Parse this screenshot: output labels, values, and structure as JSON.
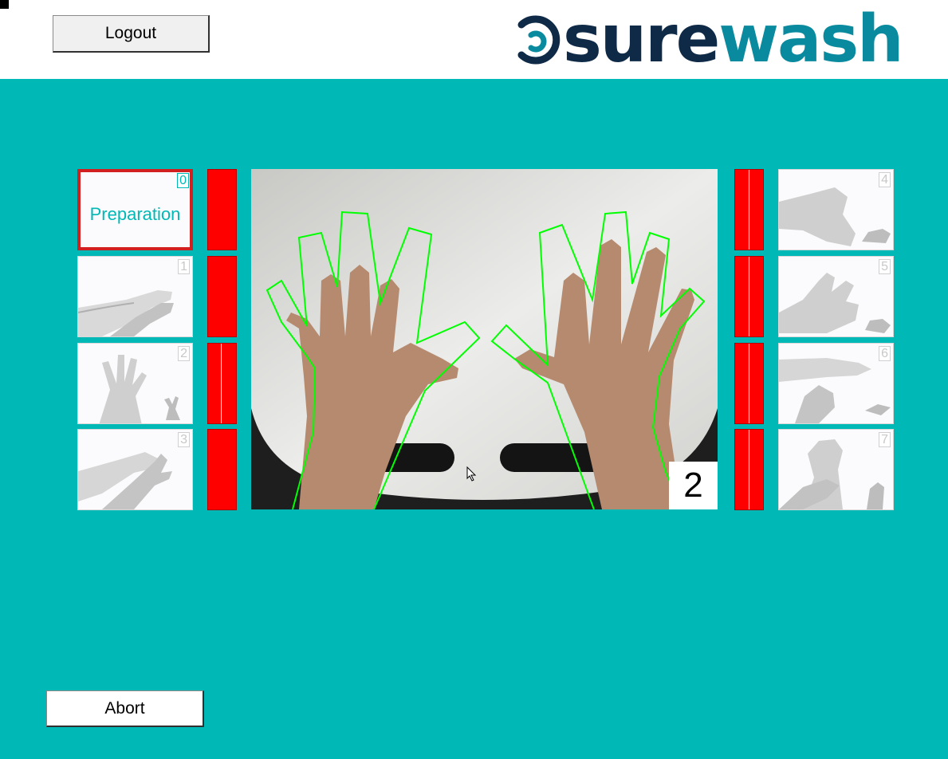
{
  "header": {
    "logout_label": "Logout",
    "logo": {
      "part1": "sure",
      "part2": "wash"
    }
  },
  "steps": {
    "left": [
      {
        "number": "0",
        "label": "Preparation",
        "active": true,
        "icon": "preparation-icon"
      },
      {
        "number": "1",
        "label": "",
        "active": false,
        "icon": "palm-to-palm-icon"
      },
      {
        "number": "2",
        "label": "",
        "active": false,
        "icon": "fingers-interlaced-icon"
      },
      {
        "number": "3",
        "label": "",
        "active": false,
        "icon": "palm-over-back-icon"
      }
    ],
    "right": [
      {
        "number": "4",
        "label": "",
        "active": false,
        "icon": "fingers-locked-icon"
      },
      {
        "number": "5",
        "label": "",
        "active": false,
        "icon": "thumb-rotation-icon"
      },
      {
        "number": "6",
        "label": "",
        "active": false,
        "icon": "fingertips-palm-icon"
      },
      {
        "number": "7",
        "label": "",
        "active": false,
        "icon": "wrist-rub-icon"
      }
    ]
  },
  "progress": {
    "left_bars": [
      0,
      0,
      0,
      0
    ],
    "right_bars": [
      0,
      0,
      0,
      0
    ]
  },
  "camera": {
    "counter": "2"
  },
  "footer": {
    "abort_label": "Abort"
  },
  "colors": {
    "background": "#00b9b6",
    "progress_bar": "#ff0000",
    "hand_outline": "#00ff00",
    "active_border": "#d21f1f",
    "logo_dark": "#0e2a47",
    "logo_teal": "#0a8a9e"
  }
}
